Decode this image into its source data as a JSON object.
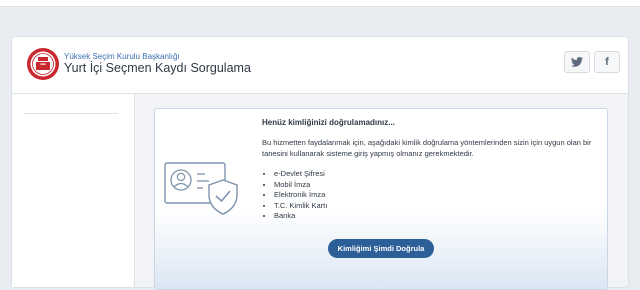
{
  "header": {
    "organization": "Yüksek Seçim Kurulu Başkanlığı",
    "title": "Yurt İçi Seçmen Kaydı Sorgulama",
    "social": {
      "twitter_icon": "twitter-icon",
      "facebook_glyph": "f"
    }
  },
  "verification": {
    "heading": "Henüz kimliğinizi doğrulamadınız...",
    "description": "Bu hizmetten faydalanmak için, aşağıdaki kimlik doğrulama yöntemlerinden sizin için uygun olan bir tanesini kullanarak sisteme giriş yapmış olmanız gerekmektedir.",
    "methods": [
      "e-Devlet Şifresi",
      "Mobil İmza",
      "Elektronik İmza",
      "T.C. Kimlik Kartı",
      "Banka"
    ],
    "button_label": "Kimliğimi Şimdi Doğrula",
    "illustration_icon": "id-card-shield-icon"
  },
  "colors": {
    "brand_blue": "#2c5f97",
    "link_blue": "#3a6fb0",
    "logo_red": "#c8282e",
    "page_bg": "#e9ecf0"
  }
}
